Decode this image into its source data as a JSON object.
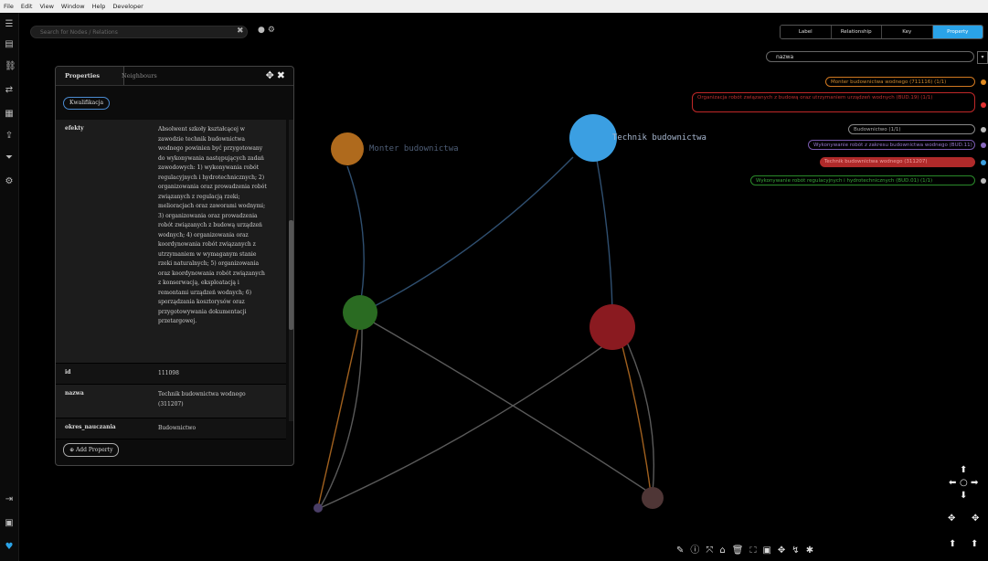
{
  "menubar": {
    "items": [
      "File",
      "Edit",
      "View",
      "Window",
      "Help",
      "Developer"
    ]
  },
  "search": {
    "placeholder": "Search for Nodes / Relations"
  },
  "panel": {
    "tabs": [
      {
        "label": "Properties",
        "active": true
      },
      {
        "label": "Neighbours",
        "active": false
      }
    ],
    "chip_label": "Kwalifikacja",
    "properties": [
      {
        "key": "efekty",
        "value": "Absolwent szkoły kształcącej w zawodzie technik budownictwa wodnego powinien być przygotowany do wykonywania następujących zadań zawodowych: 1) wykonywania robót regulacyjnych i hydrotechnicznych; 2) organizowania oraz prowadzenia robót związanych z regulacją rzeki; melioracjach oraz zaworami wodnymi; 3) organizowania oraz prowadzenia robót związanych z budową urządzeń wodnych; 4) organizowania oraz koordynowania robót związanych z utrzymaniem w wymaganym stanie rzeki naturalnych; 5) organizowania oraz koordynowania robót związanych z konserwacją, eksploatacją i remontami urządzeń wodnych; 6) sporządzania kosztorysów oraz przygotowywania dokumentacji przetargowej."
      },
      {
        "key": "id",
        "value": "111098"
      },
      {
        "key": "nazwa",
        "value": "Technik budownictwa wodnego (311207)"
      },
      {
        "key": "okres_nauczania",
        "value": "Budownictwo"
      }
    ],
    "add_property_label": "Add Property"
  },
  "filter_tabs": [
    {
      "label": "Label",
      "selected": false
    },
    {
      "label": "Relationship",
      "selected": false
    },
    {
      "label": "Key",
      "selected": false
    },
    {
      "label": "Property",
      "selected": true
    }
  ],
  "field_select": {
    "value": "nazwa"
  },
  "legend": [
    {
      "text": "Monter budownictwa wodnego (711116) (1/1)",
      "color": "#d07820",
      "dot": "#e08a20"
    },
    {
      "text": "Organizacja robót związanych z budową oraz utrzymaniem urządzeń wodnych (BUD.19) (1/1)",
      "color": "#c02828",
      "dot": "#e03030"
    },
    {
      "text": "Budownictwo (1/1)",
      "color": "#888888",
      "dot": "#bbbbbb"
    },
    {
      "text": "Wykonywanie robót z zakresu budownictwa wodnego (BUD.11) (1/1)",
      "color": "#7a5ab0",
      "dot": "#8a6ac0"
    },
    {
      "text": "Technik budownictwa wodnego (311207)",
      "color": "#c03030",
      "dot": "#3a9fe0",
      "filled": true
    },
    {
      "text": "Wykonywanie robót regulacyjnych i hydrotechnicznych (BUD.01) (1/1)",
      "color": "#2a8a2a",
      "dot": "#bbbbbb"
    }
  ],
  "graph": {
    "nodes": [
      {
        "id": "orange",
        "label": "Monter budownictwa",
        "color": "#c87a28"
      },
      {
        "id": "blue",
        "label": "Technik budownictwa",
        "color": "#3a9ee0"
      },
      {
        "id": "green",
        "label": "",
        "color": "#2a7a2a"
      },
      {
        "id": "red",
        "label": "",
        "color": "#8a1c22"
      },
      {
        "id": "small-purple",
        "label": "",
        "color": "#5a4a78"
      },
      {
        "id": "small-brown",
        "label": "",
        "color": "#5a3e3e"
      }
    ]
  },
  "bottom_tools": [
    "edit-icon",
    "info-icon",
    "expand-icon",
    "tag-icon",
    "delete-icon",
    "fullscreen-icon",
    "screenshot-icon",
    "settings-icon",
    "share-icon",
    "bug-icon"
  ],
  "colors": {
    "accent": "#2aa3e8"
  }
}
